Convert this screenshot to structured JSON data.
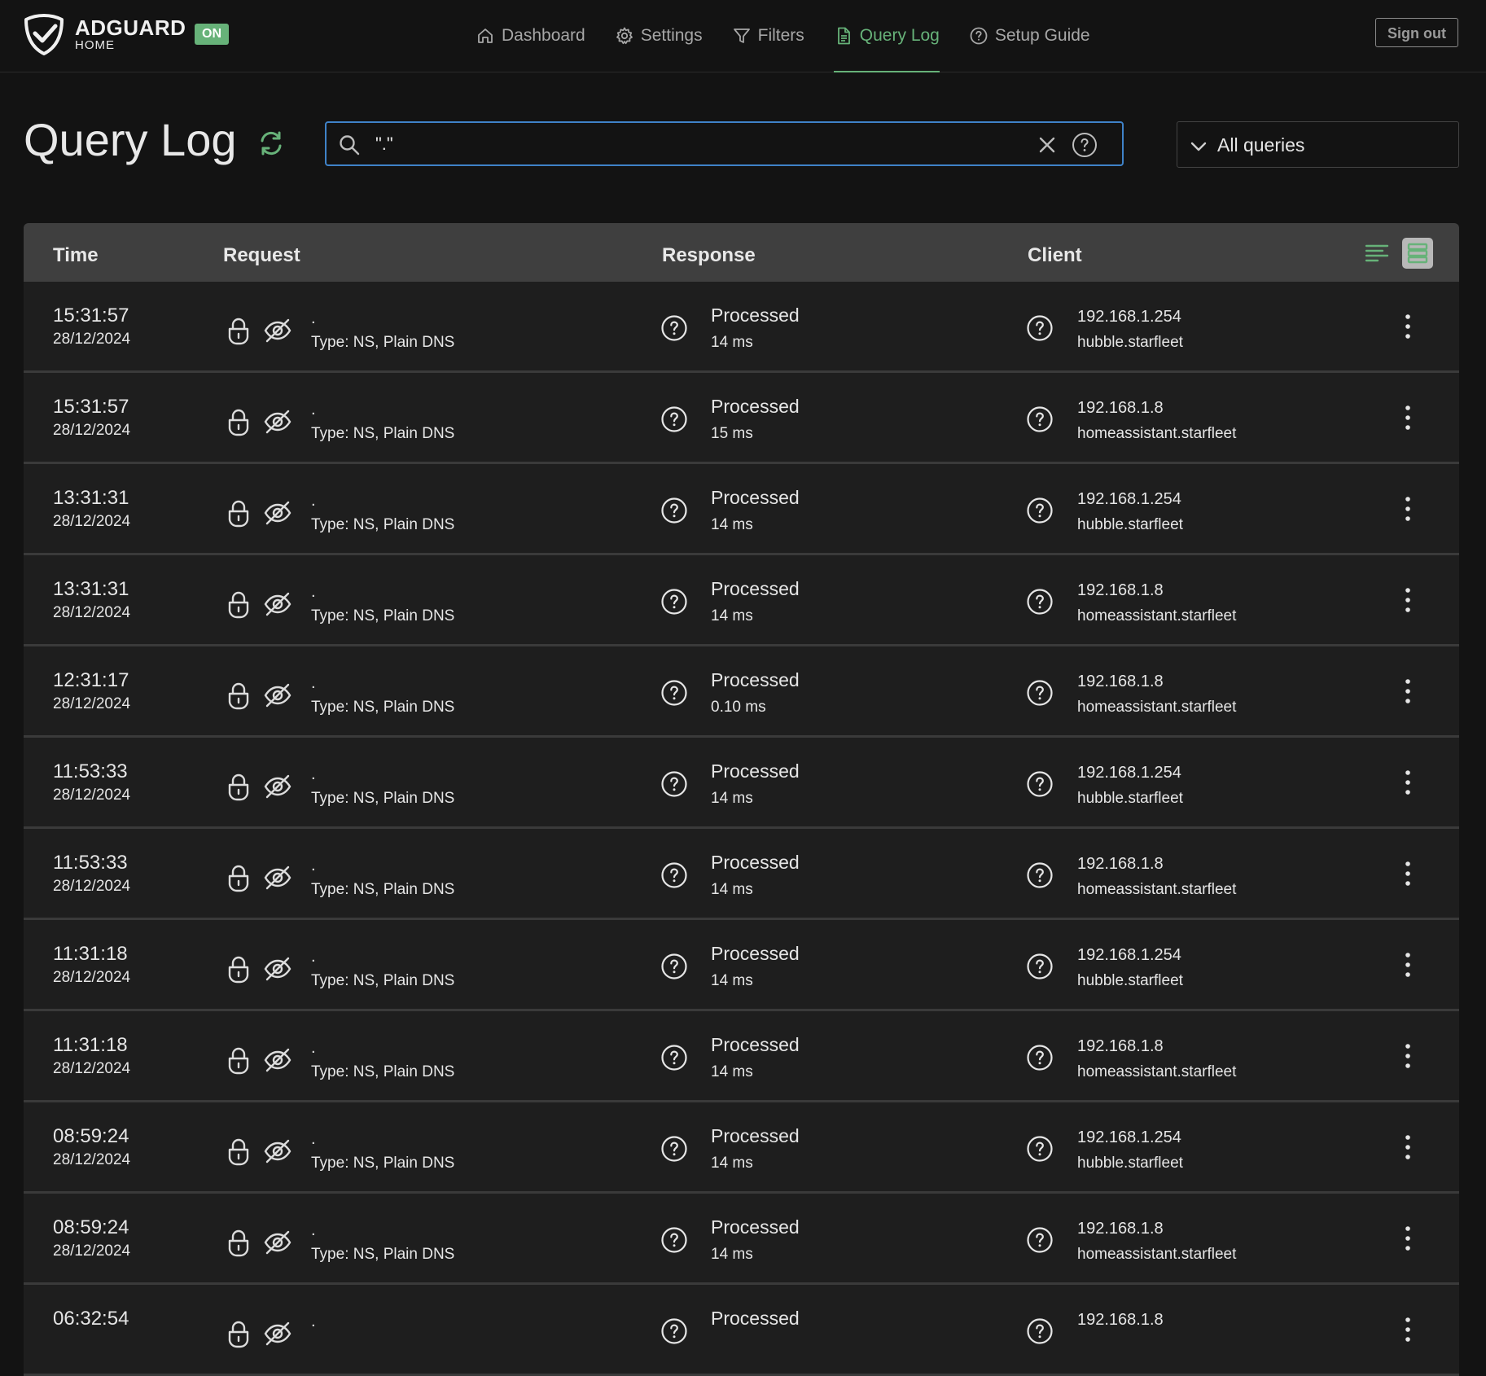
{
  "brand": {
    "name": "ADGUARD",
    "sub": "HOME",
    "status": "ON"
  },
  "colors": {
    "accent": "#67b279",
    "focus": "#3f82c8",
    "background": "#131313",
    "row": "#1e1e1e"
  },
  "nav": [
    {
      "label": "Dashboard",
      "icon": "home-icon"
    },
    {
      "label": "Settings",
      "icon": "gear-icon"
    },
    {
      "label": "Filters",
      "icon": "filter-icon"
    },
    {
      "label": "Query Log",
      "icon": "document-icon",
      "active": true
    },
    {
      "label": "Setup Guide",
      "icon": "help-circle-icon"
    }
  ],
  "signout_label": "Sign out",
  "page": {
    "title": "Query Log",
    "search_value": "\".\"",
    "filter_selected": "All queries"
  },
  "table": {
    "headers": {
      "time": "Time",
      "request": "Request",
      "response": "Response",
      "client": "Client"
    },
    "rows": [
      {
        "time": "15:31:57",
        "date": "28/12/2024",
        "domain": ".",
        "type": "Type: NS, Plain DNS",
        "status": "Processed",
        "elapsed": "14 ms",
        "ip": "192.168.1.254",
        "name": "hubble.starfleet"
      },
      {
        "time": "15:31:57",
        "date": "28/12/2024",
        "domain": ".",
        "type": "Type: NS, Plain DNS",
        "status": "Processed",
        "elapsed": "15 ms",
        "ip": "192.168.1.8",
        "name": "homeassistant.starfleet"
      },
      {
        "time": "13:31:31",
        "date": "28/12/2024",
        "domain": ".",
        "type": "Type: NS, Plain DNS",
        "status": "Processed",
        "elapsed": "14 ms",
        "ip": "192.168.1.254",
        "name": "hubble.starfleet"
      },
      {
        "time": "13:31:31",
        "date": "28/12/2024",
        "domain": ".",
        "type": "Type: NS, Plain DNS",
        "status": "Processed",
        "elapsed": "14 ms",
        "ip": "192.168.1.8",
        "name": "homeassistant.starfleet"
      },
      {
        "time": "12:31:17",
        "date": "28/12/2024",
        "domain": ".",
        "type": "Type: NS, Plain DNS",
        "status": "Processed",
        "elapsed": "0.10 ms",
        "ip": "192.168.1.8",
        "name": "homeassistant.starfleet"
      },
      {
        "time": "11:53:33",
        "date": "28/12/2024",
        "domain": ".",
        "type": "Type: NS, Plain DNS",
        "status": "Processed",
        "elapsed": "14 ms",
        "ip": "192.168.1.254",
        "name": "hubble.starfleet"
      },
      {
        "time": "11:53:33",
        "date": "28/12/2024",
        "domain": ".",
        "type": "Type: NS, Plain DNS",
        "status": "Processed",
        "elapsed": "14 ms",
        "ip": "192.168.1.8",
        "name": "homeassistant.starfleet"
      },
      {
        "time": "11:31:18",
        "date": "28/12/2024",
        "domain": ".",
        "type": "Type: NS, Plain DNS",
        "status": "Processed",
        "elapsed": "14 ms",
        "ip": "192.168.1.254",
        "name": "hubble.starfleet"
      },
      {
        "time": "11:31:18",
        "date": "28/12/2024",
        "domain": ".",
        "type": "Type: NS, Plain DNS",
        "status": "Processed",
        "elapsed": "14 ms",
        "ip": "192.168.1.8",
        "name": "homeassistant.starfleet"
      },
      {
        "time": "08:59:24",
        "date": "28/12/2024",
        "domain": ".",
        "type": "Type: NS, Plain DNS",
        "status": "Processed",
        "elapsed": "14 ms",
        "ip": "192.168.1.254",
        "name": "hubble.starfleet"
      },
      {
        "time": "08:59:24",
        "date": "28/12/2024",
        "domain": ".",
        "type": "Type: NS, Plain DNS",
        "status": "Processed",
        "elapsed": "14 ms",
        "ip": "192.168.1.8",
        "name": "homeassistant.starfleet"
      },
      {
        "time": "06:32:54",
        "date": "",
        "domain": ".",
        "type": "",
        "status": "Processed",
        "elapsed": "",
        "ip": "192.168.1.8",
        "name": ""
      }
    ]
  }
}
